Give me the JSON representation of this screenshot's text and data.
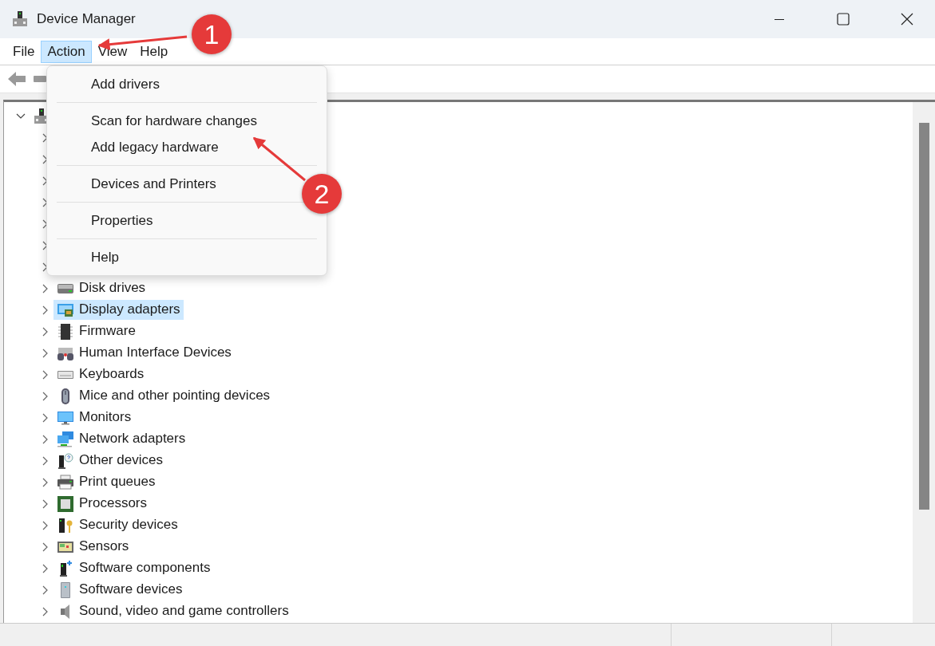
{
  "window": {
    "title": "Device Manager"
  },
  "menu_bar": [
    {
      "label": "File",
      "selected": false
    },
    {
      "label": "Action",
      "selected": true
    },
    {
      "label": "View",
      "selected": false
    },
    {
      "label": "Help",
      "selected": false
    }
  ],
  "dropdown": [
    {
      "kind": "item",
      "label": "Add drivers"
    },
    {
      "kind": "separator"
    },
    {
      "kind": "item",
      "label": "Scan for hardware changes"
    },
    {
      "kind": "item",
      "label": "Add legacy hardware"
    },
    {
      "kind": "separator"
    },
    {
      "kind": "item",
      "label": "Devices and Printers"
    },
    {
      "kind": "separator"
    },
    {
      "kind": "item",
      "label": "Properties"
    },
    {
      "kind": "separator"
    },
    {
      "kind": "item",
      "label": "Help"
    }
  ],
  "tree": {
    "expanded": true,
    "children": [
      {
        "kind": "covered"
      },
      {
        "kind": "covered"
      },
      {
        "kind": "covered"
      },
      {
        "kind": "covered"
      },
      {
        "kind": "covered"
      },
      {
        "kind": "covered"
      },
      {
        "kind": "covered"
      },
      {
        "kind": "disk",
        "label": "Disk drives",
        "selected": false
      },
      {
        "kind": "display",
        "label": "Display adapters",
        "selected": true
      },
      {
        "kind": "chip",
        "label": "Firmware",
        "selected": false
      },
      {
        "kind": "hid",
        "label": "Human Interface Devices",
        "selected": false
      },
      {
        "kind": "keyboard",
        "label": "Keyboards",
        "selected": false
      },
      {
        "kind": "mouse",
        "label": "Mice and other pointing devices",
        "selected": false
      },
      {
        "kind": "monitor",
        "label": "Monitors",
        "selected": false
      },
      {
        "kind": "network",
        "label": "Network adapters",
        "selected": false
      },
      {
        "kind": "other",
        "label": "Other devices",
        "selected": false
      },
      {
        "kind": "printer",
        "label": "Print queues",
        "selected": false
      },
      {
        "kind": "processor",
        "label": "Processors",
        "selected": false
      },
      {
        "kind": "security",
        "label": "Security devices",
        "selected": false
      },
      {
        "kind": "sensor",
        "label": "Sensors",
        "selected": false
      },
      {
        "kind": "swcomp",
        "label": "Software components",
        "selected": false
      },
      {
        "kind": "swdev",
        "label": "Software devices",
        "selected": false
      },
      {
        "kind": "sound",
        "label": "Sound, video and game controllers",
        "selected": false
      }
    ]
  },
  "annotations": [
    {
      "label": "1"
    },
    {
      "label": "2"
    }
  ]
}
